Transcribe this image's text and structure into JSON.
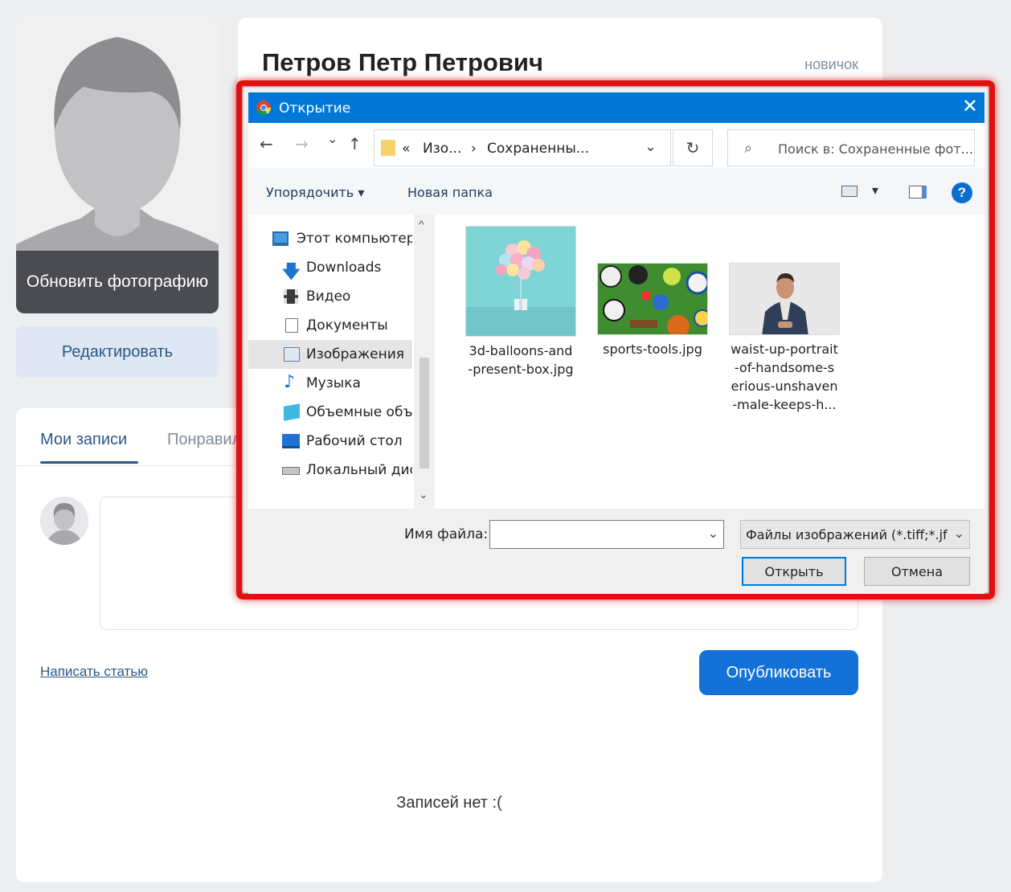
{
  "profile": {
    "update_photo": "Обновить фотографию",
    "edit": "Редактировать",
    "name": "Петров Петр Петрович",
    "status": "новичок"
  },
  "posts": {
    "tabs": [
      {
        "label": "Мои записи"
      },
      {
        "label": "Понравились"
      }
    ],
    "write_link": "Написать статью",
    "publish": "Опубликовать",
    "empty": "Записей нет :("
  },
  "dialog": {
    "title": "Открытие",
    "close": "✕",
    "nav": {
      "back": "←",
      "forward": "→",
      "recent": "⌄",
      "up": "↑"
    },
    "address": {
      "prefix": "«",
      "part1": "Изо...",
      "sep": "›",
      "part2": "Сохраненны..."
    },
    "refresh": "↻",
    "search_placeholder": "Поиск в: Сохраненные фот...",
    "toolbar": {
      "organize": "Упорядочить ▾",
      "new_folder": "Новая папка"
    },
    "help": "?",
    "sidebar": [
      {
        "label": "Этот компьютер",
        "icon": "computer-icon"
      },
      {
        "label": "Downloads",
        "icon": "download-icon"
      },
      {
        "label": "Видео",
        "icon": "video-icon"
      },
      {
        "label": "Документы",
        "icon": "document-icon"
      },
      {
        "label": "Изображения",
        "icon": "pictures-icon",
        "selected": true
      },
      {
        "label": "Музыка",
        "icon": "music-icon"
      },
      {
        "label": "Объемные объекты",
        "icon": "3d-objects-icon"
      },
      {
        "label": "Рабочий стол",
        "icon": "desktop-icon"
      },
      {
        "label": "Локальный диск",
        "icon": "local-disk-icon"
      }
    ],
    "files": [
      {
        "name": "3d-balloons-and\n-present-box.jpg"
      },
      {
        "name": "sports-tools.jpg"
      },
      {
        "name": "waist-up-portrait\n-of-handsome-s\nerious-unshaven\n-male-keeps-h..."
      }
    ],
    "filename_label": "Имя файла:",
    "filename_value": "",
    "filetype": "Файлы изображений (*.tiff;*.jf",
    "open": "Открыть",
    "cancel": "Отмена"
  },
  "colors": {
    "accent": "#1371d8",
    "link": "#2a5885",
    "dialog_title": "#0078d7",
    "highlight_border": "#e01010"
  }
}
